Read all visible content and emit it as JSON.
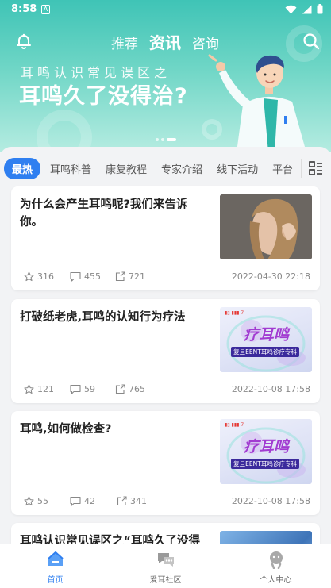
{
  "status_bar": {
    "time": "8:58",
    "sim_icon": "sim-card-icon",
    "wifi_icon": "wifi-icon",
    "signal_icon": "signal-icon",
    "battery_icon": "battery-icon"
  },
  "header": {
    "tabs": [
      {
        "label": "推荐",
        "active": false
      },
      {
        "label": "资讯",
        "active": true
      },
      {
        "label": "咨询",
        "active": false
      }
    ],
    "bell_icon": "bell-icon",
    "search_icon": "search-icon"
  },
  "banner": {
    "kicker": "耳鸣认识常见误区之",
    "headline": "耳鸣久了没得治?",
    "page_count": 3,
    "active_page": 3
  },
  "categories": {
    "items": [
      "最热",
      "耳鸣科普",
      "康复教程",
      "专家介绍",
      "线下活动",
      "平台"
    ],
    "active_index": 0,
    "menu_icon": "grid-list-icon"
  },
  "articles": [
    {
      "title": "为什么会产生耳鸣呢?我们来告诉你。",
      "likes": "316",
      "comments": "455",
      "shares": "721",
      "date": "2022-04-30 22:18",
      "thumb": "woman-ear-photo"
    },
    {
      "title": "打破纸老虎,耳鸣的认知行为疗法",
      "likes": "121",
      "comments": "59",
      "shares": "765",
      "date": "2022-10-08 17:58",
      "thumb": "promo"
    },
    {
      "title": "耳鸣,如何做检查?",
      "likes": "55",
      "comments": "42",
      "shares": "341",
      "date": "2022-10-08 17:58",
      "thumb": "promo"
    },
    {
      "title": "耳鸣认识常见误区之“耳鸣久了没得",
      "thumb": "blue-image"
    }
  ],
  "promo": {
    "main": "疗耳鸣",
    "band": "复旦EENT耳鸣诊疗专科"
  },
  "colors": {
    "accent": "#2f7ff0",
    "banner_teal": "#3fc4b6"
  },
  "tabbar": [
    {
      "label": "首页",
      "icon": "home-icon",
      "active": true
    },
    {
      "label": "爱耳社区",
      "icon": "community-chat-icon",
      "active": false
    },
    {
      "label": "个人中心",
      "icon": "profile-icon",
      "active": false
    }
  ]
}
